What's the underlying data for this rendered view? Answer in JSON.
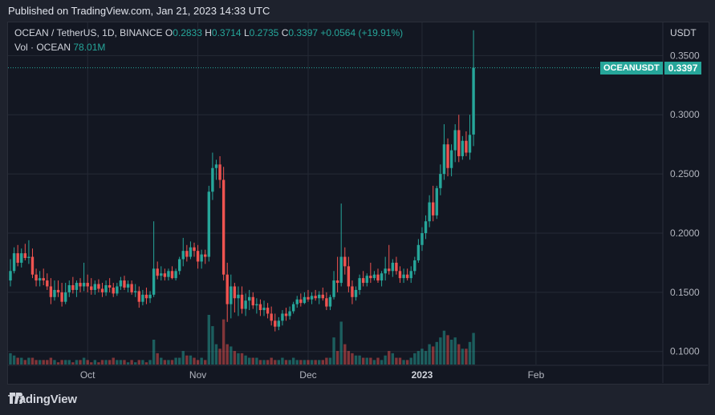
{
  "header": {
    "published": "Published on TradingView.com, Jan 21, 2023 14:33 UTC"
  },
  "legend": {
    "symbol": "OCEAN / TetherUS, 1D, BINANCE",
    "o_label": "O",
    "o_value": "0.2833",
    "h_label": "H",
    "h_value": "0.3714",
    "l_label": "L",
    "l_value": "0.2735",
    "c_label": "C",
    "c_value": "0.3397",
    "change": "+0.0564 (+19.91%)",
    "vol_label": "Vol · OCEAN",
    "vol_value": "78.01M"
  },
  "axis": {
    "currency": "USDT"
  },
  "price_tag": {
    "symbol": "OCEANUSDT",
    "value": "0.3397"
  },
  "footer": {
    "brand": "TradingView"
  },
  "colors": {
    "up": "#26a69a",
    "down": "#ef5350",
    "up_vol": "#26a69a80",
    "down_vol": "#ef535080"
  },
  "chart_data": {
    "type": "candlestick",
    "y_ticks": [
      "0.1000",
      "0.1500",
      "0.2000",
      "0.2500",
      "0.3000",
      "0.3500"
    ],
    "y_tick_values": [
      0.1,
      0.15,
      0.2,
      0.25,
      0.3,
      0.35
    ],
    "ylim": [
      0.089,
      0.378
    ],
    "x_ticks": [
      {
        "label": "Oct",
        "index": 21,
        "bold": false
      },
      {
        "label": "Nov",
        "index": 51,
        "bold": false
      },
      {
        "label": "Dec",
        "index": 81,
        "bold": false
      },
      {
        "label": "2023",
        "index": 112,
        "bold": true
      },
      {
        "label": "Feb",
        "index": 143,
        "bold": false
      }
    ],
    "grid": true,
    "last_price": 0.3397,
    "candles": [
      [
        0.16,
        0.178,
        0.155,
        0.168,
        5
      ],
      [
        0.168,
        0.188,
        0.166,
        0.183,
        4
      ],
      [
        0.183,
        0.19,
        0.172,
        0.175,
        3
      ],
      [
        0.175,
        0.187,
        0.171,
        0.183,
        3
      ],
      [
        0.183,
        0.191,
        0.177,
        0.179,
        2
      ],
      [
        0.179,
        0.194,
        0.174,
        0.18,
        3
      ],
      [
        0.18,
        0.187,
        0.162,
        0.165,
        3
      ],
      [
        0.165,
        0.17,
        0.155,
        0.16,
        2
      ],
      [
        0.16,
        0.168,
        0.155,
        0.162,
        2
      ],
      [
        0.162,
        0.17,
        0.156,
        0.16,
        2
      ],
      [
        0.16,
        0.166,
        0.152,
        0.155,
        2
      ],
      [
        0.155,
        0.162,
        0.14,
        0.146,
        3
      ],
      [
        0.146,
        0.16,
        0.143,
        0.152,
        2
      ],
      [
        0.152,
        0.16,
        0.146,
        0.15,
        1
      ],
      [
        0.15,
        0.158,
        0.138,
        0.142,
        2
      ],
      [
        0.142,
        0.158,
        0.14,
        0.15,
        2
      ],
      [
        0.15,
        0.16,
        0.146,
        0.156,
        2
      ],
      [
        0.156,
        0.163,
        0.149,
        0.152,
        1
      ],
      [
        0.152,
        0.16,
        0.146,
        0.158,
        2
      ],
      [
        0.158,
        0.162,
        0.15,
        0.155,
        2
      ],
      [
        0.155,
        0.175,
        0.151,
        0.158,
        3
      ],
      [
        0.158,
        0.165,
        0.15,
        0.155,
        2
      ],
      [
        0.155,
        0.162,
        0.148,
        0.152,
        1
      ],
      [
        0.152,
        0.16,
        0.148,
        0.157,
        2
      ],
      [
        0.157,
        0.161,
        0.15,
        0.153,
        1
      ],
      [
        0.153,
        0.158,
        0.146,
        0.15,
        2
      ],
      [
        0.15,
        0.16,
        0.147,
        0.156,
        2
      ],
      [
        0.156,
        0.162,
        0.15,
        0.154,
        2
      ],
      [
        0.154,
        0.158,
        0.146,
        0.149,
        3
      ],
      [
        0.149,
        0.158,
        0.147,
        0.155,
        2
      ],
      [
        0.155,
        0.163,
        0.152,
        0.16,
        2
      ],
      [
        0.16,
        0.164,
        0.152,
        0.154,
        2
      ],
      [
        0.154,
        0.16,
        0.15,
        0.157,
        1
      ],
      [
        0.157,
        0.16,
        0.148,
        0.15,
        2
      ],
      [
        0.15,
        0.157,
        0.146,
        0.151,
        1
      ],
      [
        0.151,
        0.155,
        0.137,
        0.142,
        2
      ],
      [
        0.142,
        0.152,
        0.139,
        0.148,
        2
      ],
      [
        0.148,
        0.154,
        0.14,
        0.145,
        1
      ],
      [
        0.145,
        0.151,
        0.141,
        0.148,
        2
      ],
      [
        0.148,
        0.21,
        0.146,
        0.17,
        11
      ],
      [
        0.17,
        0.176,
        0.161,
        0.164,
        5
      ],
      [
        0.164,
        0.172,
        0.16,
        0.166,
        3
      ],
      [
        0.166,
        0.17,
        0.16,
        0.163,
        2
      ],
      [
        0.163,
        0.17,
        0.16,
        0.168,
        2
      ],
      [
        0.168,
        0.172,
        0.161,
        0.162,
        2
      ],
      [
        0.162,
        0.17,
        0.16,
        0.168,
        3
      ],
      [
        0.168,
        0.18,
        0.165,
        0.178,
        3
      ],
      [
        0.178,
        0.196,
        0.172,
        0.185,
        6
      ],
      [
        0.185,
        0.19,
        0.176,
        0.18,
        4
      ],
      [
        0.18,
        0.193,
        0.178,
        0.188,
        4
      ],
      [
        0.188,
        0.192,
        0.18,
        0.185,
        3
      ],
      [
        0.185,
        0.19,
        0.17,
        0.176,
        2
      ],
      [
        0.176,
        0.186,
        0.17,
        0.182,
        3
      ],
      [
        0.182,
        0.186,
        0.174,
        0.18,
        2
      ],
      [
        0.18,
        0.24,
        0.176,
        0.235,
        22
      ],
      [
        0.235,
        0.268,
        0.228,
        0.255,
        17
      ],
      [
        0.255,
        0.262,
        0.245,
        0.258,
        9
      ],
      [
        0.258,
        0.265,
        0.238,
        0.245,
        7
      ],
      [
        0.245,
        0.256,
        0.16,
        0.165,
        20
      ],
      [
        0.165,
        0.175,
        0.125,
        0.14,
        9
      ],
      [
        0.14,
        0.165,
        0.128,
        0.155,
        8
      ],
      [
        0.155,
        0.158,
        0.133,
        0.145,
        6
      ],
      [
        0.145,
        0.155,
        0.13,
        0.148,
        5
      ],
      [
        0.148,
        0.155,
        0.132,
        0.136,
        5
      ],
      [
        0.136,
        0.149,
        0.13,
        0.143,
        4
      ],
      [
        0.143,
        0.152,
        0.135,
        0.146,
        3
      ],
      [
        0.146,
        0.15,
        0.136,
        0.139,
        3
      ],
      [
        0.139,
        0.145,
        0.132,
        0.14,
        3
      ],
      [
        0.14,
        0.144,
        0.13,
        0.135,
        2
      ],
      [
        0.135,
        0.143,
        0.13,
        0.137,
        2
      ],
      [
        0.137,
        0.141,
        0.128,
        0.132,
        2
      ],
      [
        0.132,
        0.138,
        0.122,
        0.126,
        3
      ],
      [
        0.126,
        0.132,
        0.117,
        0.121,
        2
      ],
      [
        0.121,
        0.129,
        0.118,
        0.126,
        2
      ],
      [
        0.126,
        0.135,
        0.122,
        0.132,
        3
      ],
      [
        0.132,
        0.137,
        0.126,
        0.13,
        2
      ],
      [
        0.13,
        0.138,
        0.127,
        0.134,
        2
      ],
      [
        0.134,
        0.142,
        0.132,
        0.14,
        3
      ],
      [
        0.14,
        0.147,
        0.137,
        0.144,
        2
      ],
      [
        0.144,
        0.149,
        0.138,
        0.141,
        2
      ],
      [
        0.141,
        0.15,
        0.14,
        0.146,
        2
      ],
      [
        0.146,
        0.152,
        0.142,
        0.144,
        2
      ],
      [
        0.144,
        0.15,
        0.14,
        0.147,
        2
      ],
      [
        0.147,
        0.152,
        0.143,
        0.145,
        2
      ],
      [
        0.145,
        0.151,
        0.14,
        0.148,
        2
      ],
      [
        0.148,
        0.154,
        0.143,
        0.145,
        2
      ],
      [
        0.145,
        0.15,
        0.135,
        0.138,
        3
      ],
      [
        0.138,
        0.148,
        0.135,
        0.146,
        3
      ],
      [
        0.146,
        0.168,
        0.144,
        0.16,
        12
      ],
      [
        0.16,
        0.18,
        0.15,
        0.158,
        6
      ],
      [
        0.158,
        0.225,
        0.155,
        0.18,
        19
      ],
      [
        0.18,
        0.188,
        0.165,
        0.172,
        9
      ],
      [
        0.172,
        0.18,
        0.15,
        0.155,
        6
      ],
      [
        0.155,
        0.16,
        0.14,
        0.146,
        5
      ],
      [
        0.146,
        0.155,
        0.143,
        0.152,
        4
      ],
      [
        0.152,
        0.165,
        0.148,
        0.162,
        4
      ],
      [
        0.162,
        0.168,
        0.155,
        0.158,
        3
      ],
      [
        0.158,
        0.166,
        0.155,
        0.164,
        3
      ],
      [
        0.164,
        0.175,
        0.158,
        0.162,
        3
      ],
      [
        0.162,
        0.168,
        0.16,
        0.165,
        2
      ],
      [
        0.165,
        0.17,
        0.158,
        0.16,
        3
      ],
      [
        0.16,
        0.168,
        0.155,
        0.166,
        2
      ],
      [
        0.166,
        0.18,
        0.16,
        0.17,
        4
      ],
      [
        0.17,
        0.19,
        0.165,
        0.168,
        6
      ],
      [
        0.168,
        0.178,
        0.163,
        0.175,
        5
      ],
      [
        0.175,
        0.18,
        0.165,
        0.168,
        3
      ],
      [
        0.168,
        0.172,
        0.158,
        0.162,
        3
      ],
      [
        0.162,
        0.17,
        0.158,
        0.165,
        2
      ],
      [
        0.165,
        0.17,
        0.16,
        0.162,
        2
      ],
      [
        0.162,
        0.172,
        0.158,
        0.168,
        3
      ],
      [
        0.168,
        0.18,
        0.165,
        0.177,
        5
      ],
      [
        0.177,
        0.195,
        0.175,
        0.19,
        6
      ],
      [
        0.19,
        0.205,
        0.185,
        0.2,
        7
      ],
      [
        0.2,
        0.215,
        0.195,
        0.21,
        6
      ],
      [
        0.21,
        0.232,
        0.205,
        0.226,
        9
      ],
      [
        0.226,
        0.24,
        0.21,
        0.215,
        8
      ],
      [
        0.215,
        0.24,
        0.212,
        0.238,
        10
      ],
      [
        0.238,
        0.258,
        0.232,
        0.25,
        12
      ],
      [
        0.25,
        0.292,
        0.245,
        0.275,
        15
      ],
      [
        0.275,
        0.28,
        0.248,
        0.255,
        13
      ],
      [
        0.255,
        0.275,
        0.248,
        0.27,
        11
      ],
      [
        0.27,
        0.292,
        0.26,
        0.287,
        12
      ],
      [
        0.287,
        0.3,
        0.26,
        0.265,
        9
      ],
      [
        0.265,
        0.282,
        0.262,
        0.278,
        7
      ],
      [
        0.278,
        0.286,
        0.265,
        0.268,
        7
      ],
      [
        0.268,
        0.3,
        0.262,
        0.283,
        10
      ],
      [
        0.2833,
        0.3714,
        0.2735,
        0.3397,
        14
      ]
    ]
  }
}
